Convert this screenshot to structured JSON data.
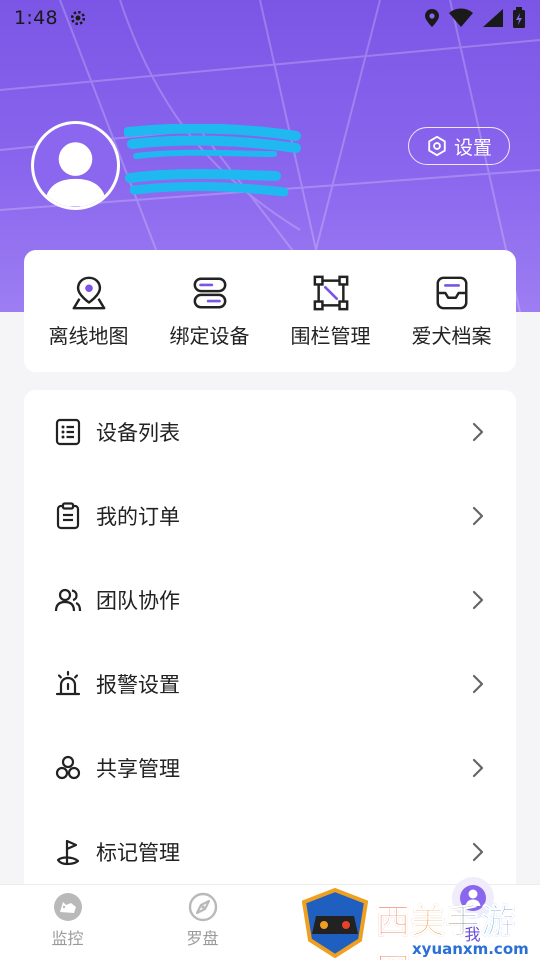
{
  "status_bar": {
    "time": "1:48"
  },
  "profile": {
    "settings_label": "设置"
  },
  "quick_actions": [
    {
      "label": "离线地图",
      "icon": "map-pin-icon"
    },
    {
      "label": "绑定设备",
      "icon": "device-bind-icon"
    },
    {
      "label": "围栏管理",
      "icon": "fence-icon"
    },
    {
      "label": "爱犬档案",
      "icon": "pet-profile-icon"
    }
  ],
  "menu": [
    {
      "label": "设备列表",
      "icon": "list-icon"
    },
    {
      "label": "我的订单",
      "icon": "clipboard-icon"
    },
    {
      "label": "团队协作",
      "icon": "team-icon"
    },
    {
      "label": "报警设置",
      "icon": "alarm-icon"
    },
    {
      "label": "共享管理",
      "icon": "share-icon"
    },
    {
      "label": "标记管理",
      "icon": "flag-icon"
    }
  ],
  "bottom_nav": [
    {
      "label": "监控",
      "icon": "monitor-dog-icon"
    },
    {
      "label": "罗盘",
      "icon": "compass-icon"
    },
    {
      "label": "",
      "icon": "game-icon"
    },
    {
      "label": "我",
      "icon": "me-icon",
      "active": true
    }
  ],
  "watermark": {
    "title": "西美手游网",
    "url": "xyuanxm.com"
  },
  "colors": {
    "primary": "#7b56e6",
    "accent": "#6a4fd8",
    "text": "#222222",
    "muted": "#9a9a9a"
  }
}
